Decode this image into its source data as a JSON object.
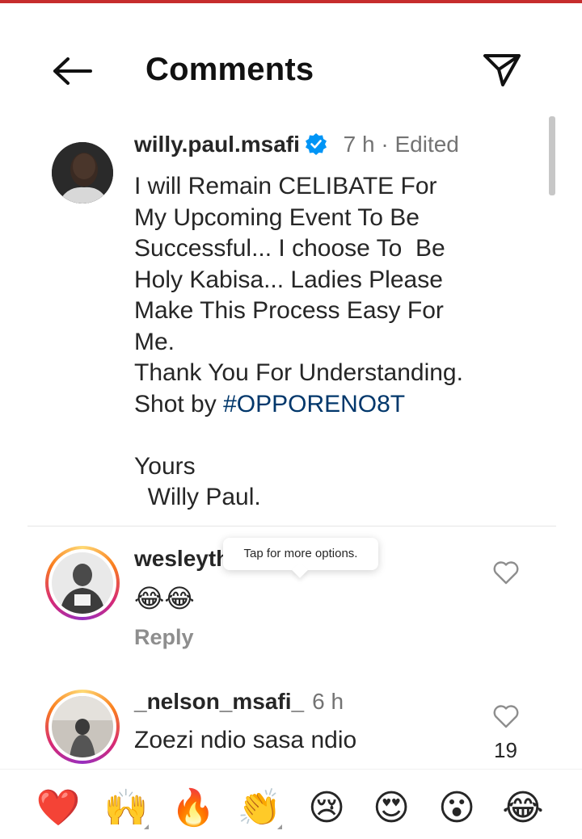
{
  "header": {
    "title": "Comments"
  },
  "caption": {
    "username": "willy.paul.msafi",
    "time": "7 h",
    "separator": " · ",
    "edited": "Edited",
    "text": "I will Remain CELIBATE For\nMy Upcoming Event To Be\nSuccessful... I choose To  Be\nHoly Kabisa... Ladies Please\nMake This Process Easy For\nMe.\nThank You For Understanding.\nShot by ",
    "hashtag": "#OPPORENO8T",
    "closing": "\n\nYours\n  Willy Paul."
  },
  "comments": [
    {
      "username": "wesleyth",
      "text": "😂😂",
      "reply_label": "Reply",
      "tooltip": "Tap for more options."
    },
    {
      "username": "_nelson_msafi_",
      "time": "6 h",
      "text": "Zoezi ndio sasa ndio",
      "likes": "19"
    }
  ],
  "emoji_bar": [
    {
      "name": "red-heart",
      "glyph": "❤️"
    },
    {
      "name": "raising-hands",
      "glyph": "🙌"
    },
    {
      "name": "fire",
      "glyph": "🔥"
    },
    {
      "name": "clapping-hands",
      "glyph": "👏"
    },
    {
      "name": "crying-face",
      "glyph": "😢"
    },
    {
      "name": "heart-eyes",
      "glyph": "😍"
    },
    {
      "name": "surprised-face",
      "glyph": "😮"
    },
    {
      "name": "tears-of-joy",
      "glyph": "😂"
    }
  ],
  "colors": {
    "accent_strip": "#c62d2d",
    "verified_blue": "#0095f6",
    "hashtag": "#00376b",
    "muted": "#737373"
  }
}
